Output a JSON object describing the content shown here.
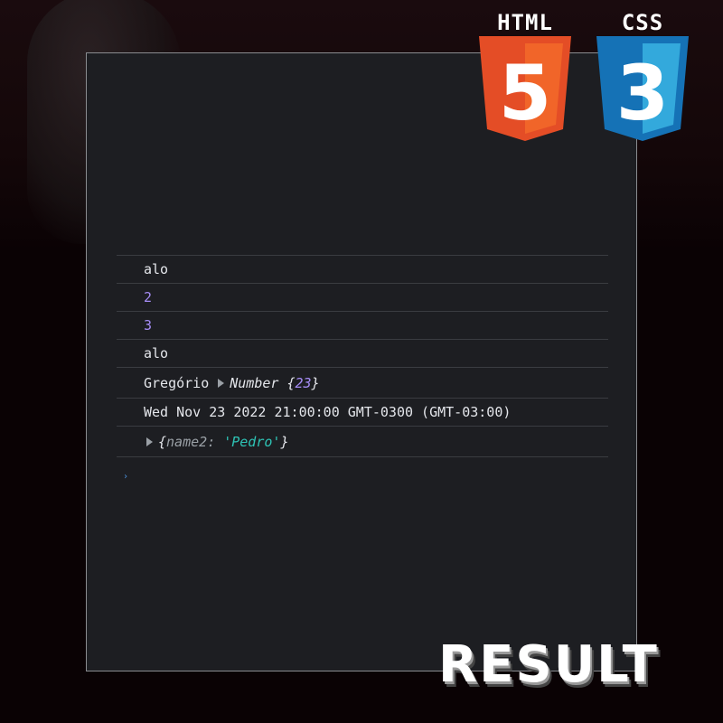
{
  "logos": {
    "html": {
      "title": "HTML",
      "digit": "5",
      "color": "#e44d26",
      "color_light": "#f16529"
    },
    "css": {
      "title": "CSS",
      "digit": "3",
      "color": "#1572b6",
      "color_light": "#33a9dc"
    }
  },
  "console": {
    "rows": [
      {
        "text": "alo"
      },
      {
        "number": "2"
      },
      {
        "number": "3"
      },
      {
        "text": "alo"
      },
      {
        "label": "Gregório",
        "type_name": "Number",
        "open_brace": "{",
        "value": "23",
        "close_brace": "}"
      },
      {
        "text": "Wed Nov 23 2022 21:00:00 GMT-0300 (GMT-03:00)"
      },
      {
        "open_brace": "{",
        "key": "name2",
        "colon": ":",
        "string": "'Pedro'",
        "close_brace": "}"
      }
    ],
    "prompt": "›"
  },
  "caption": "RESULT",
  "colors": {
    "panel": "#1d1e22",
    "number": "#a58cf5",
    "string": "#2ec4b6"
  }
}
